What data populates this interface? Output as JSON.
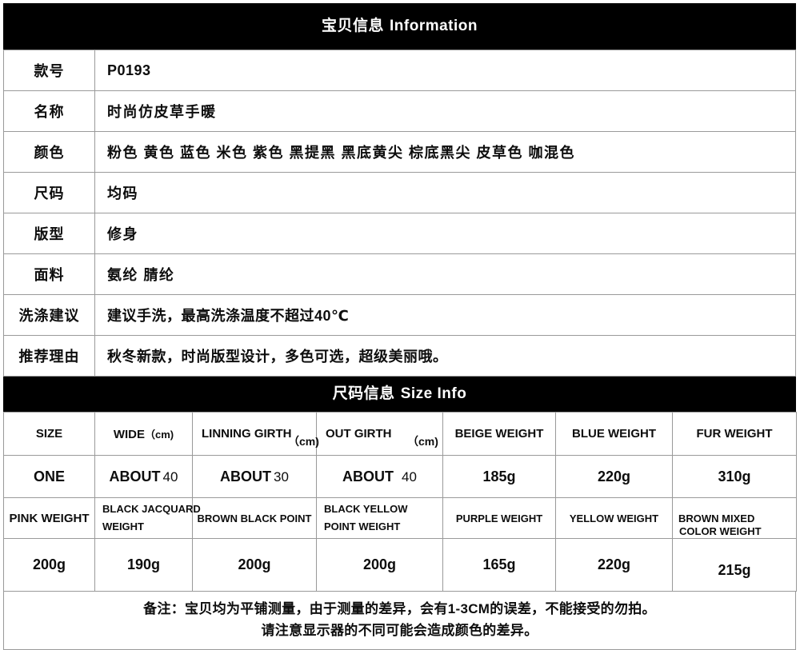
{
  "info_section": {
    "header_cn": "宝贝信息",
    "header_en": "Information",
    "rows": [
      {
        "label": "款号",
        "value": "P0193"
      },
      {
        "label": "名称",
        "value": "时尚仿皮草手暖"
      },
      {
        "label": "颜色",
        "value": "粉色 黄色 蓝色 米色 紫色 黑提黑 黑底黄尖 棕底黑尖 皮草色 咖混色"
      },
      {
        "label": "尺码",
        "value": "均码"
      },
      {
        "label": "版型",
        "value": "修身"
      },
      {
        "label": "面料",
        "value": "氨纶  腈纶"
      },
      {
        "label": "洗涤建议",
        "value": "建议手洗，最高洗涤温度不超过40℃"
      },
      {
        "label": "推荐理由",
        "value": "秋冬新款，时尚版型设计，多色可选，超级美丽哦。"
      }
    ]
  },
  "size_section": {
    "header_cn": "尺码信息",
    "header_en": "Size Info",
    "head_row_1": {
      "size": "SIZE",
      "wide": "WIDE",
      "wide_unit": "（cm)",
      "linning_girth_l1": "LINNING",
      "linning_girth_l2": "GIRTH",
      "linning_unit": "（cm)",
      "out_girth_l1": "OUT",
      "out_girth_l2": "GIRTH",
      "out_unit": "（cm)",
      "beige_weight": "BEIGE WEIGHT",
      "blue_weight": "BLUE WEIGHT",
      "fur_weight": "FUR WEIGHT"
    },
    "value_row_1": {
      "size": "ONE",
      "wide_about": "ABOUT",
      "wide_num": "40",
      "linning_about": "ABOUT",
      "linning_num": "30",
      "out_about": "ABOUT",
      "out_num": "40",
      "beige_weight": "185g",
      "blue_weight": "220g",
      "fur_weight": "310g"
    },
    "head_row_2": {
      "pink_weight": "PINK WEIGHT",
      "black_jacquard_l1": "BLACK JACQUARD",
      "black_jacquard_l2": "WEIGHT",
      "brown_black_point": "BROWN BLACK POINT",
      "black_yellow_l1": "BLACK YELLOW",
      "black_yellow_l2": "POINT WEIGHT",
      "purple_weight": "PURPLE WEIGHT",
      "yellow_weight": "YELLOW WEIGHT",
      "brown_mixed_l1": "BROWN MIXED",
      "brown_mixed_l2": "COLOR WEIGHT"
    },
    "value_row_2": {
      "pink_weight": "200g",
      "black_jacquard_weight": "190g",
      "brown_black_point": "200g",
      "black_yellow_point_weight": "200g",
      "purple_weight": "165g",
      "yellow_weight": "220g",
      "brown_mixed_color_weight": "215g"
    },
    "note_line_1": "备注：宝贝均为平铺测量，由于测量的差异，会有1-3CM的误差，不能接受的勿拍。",
    "note_line_2": "请注意显示器的不同可能会造成颜色的差异。"
  },
  "colors": {
    "header_bg": "#000000",
    "header_text": "#ffffff",
    "border": "#9a9a9a",
    "text": "#0d0d0d",
    "page_bg": "#ffffff"
  }
}
